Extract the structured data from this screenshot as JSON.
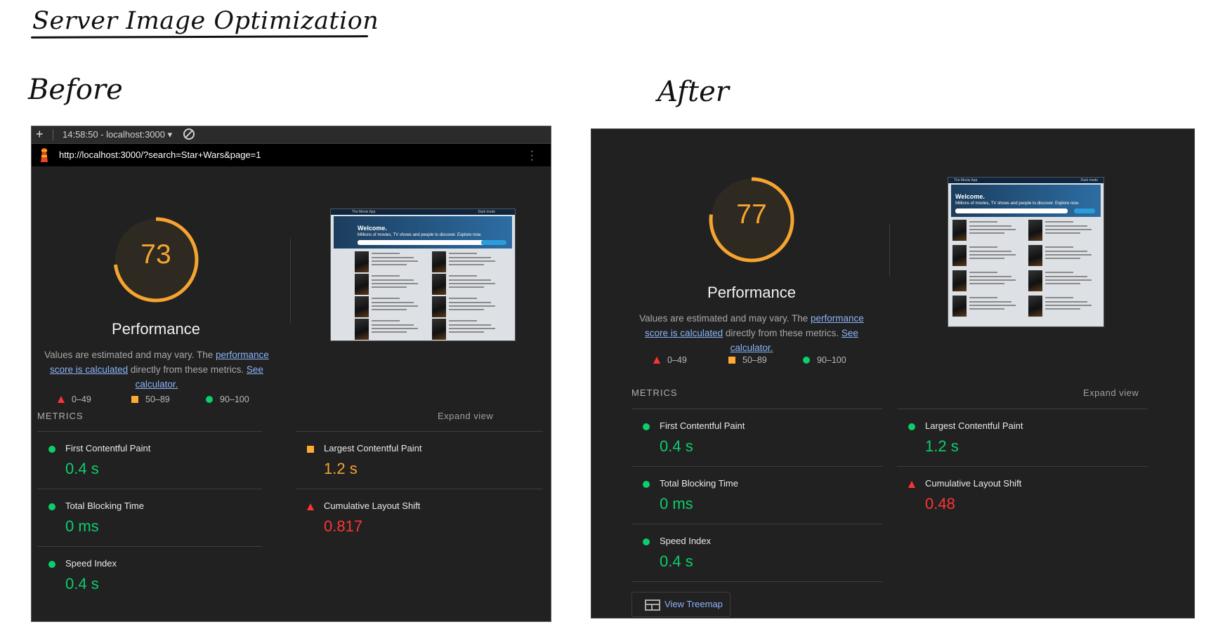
{
  "page": {
    "title": "Server Image Optimization",
    "before_label": "Before",
    "after_label": "After"
  },
  "before": {
    "devtools": {
      "session": "14:58:50 - localhost:3000 ▾",
      "url": "http://localhost:3000/?search=Star+Wars&page=1"
    },
    "score": "73",
    "score_fraction": 0.73,
    "category": "Performance",
    "desc_prefix": "Values are estimated and may vary. The ",
    "desc_link1": "performance score is calculated",
    "desc_middle": " directly from these metrics. ",
    "desc_link2": "See calculator.",
    "legend": [
      "0–49",
      "50–89",
      "90–100"
    ],
    "metrics_heading": "METRICS",
    "expand_label": "Expand view",
    "metrics": [
      {
        "label": "First Contentful Paint",
        "value": "0.4 s",
        "rating": "good"
      },
      {
        "label": "Largest Contentful Paint",
        "value": "1.2 s",
        "rating": "average"
      },
      {
        "label": "Total Blocking Time",
        "value": "0 ms",
        "rating": "good"
      },
      {
        "label": "Cumulative Layout Shift",
        "value": "0.817",
        "rating": "poor"
      },
      {
        "label": "Speed Index",
        "value": "0.4 s",
        "rating": "good"
      }
    ],
    "thumbnail": {
      "app_name": "The Movie App",
      "mode": "Dark mode",
      "welcome": "Welcome.",
      "subtitle": "Millions of movies, TV shows and people to discover. Explore now."
    }
  },
  "after": {
    "score": "77",
    "score_fraction": 0.77,
    "category": "Performance",
    "desc_prefix": "Values are estimated and may vary. The ",
    "desc_link1": "performance score is calculated",
    "desc_middle": " directly from these metrics. ",
    "desc_link2": "See calculator.",
    "legend": [
      "0–49",
      "50–89",
      "90–100"
    ],
    "metrics_heading": "METRICS",
    "expand_label": "Expand view",
    "metrics": [
      {
        "label": "First Contentful Paint",
        "value": "0.4 s",
        "rating": "good"
      },
      {
        "label": "Largest Contentful Paint",
        "value": "1.2 s",
        "rating": "good"
      },
      {
        "label": "Total Blocking Time",
        "value": "0 ms",
        "rating": "good"
      },
      {
        "label": "Cumulative Layout Shift",
        "value": "0.48",
        "rating": "poor"
      },
      {
        "label": "Speed Index",
        "value": "0.4 s",
        "rating": "good"
      }
    ],
    "treemap_label": "View Treemap",
    "thumbnail": {
      "app_name": "The Movie App",
      "mode": "Dark mode",
      "welcome": "Welcome.",
      "subtitle": "Millions of movies, TV shows and people to discover. Explore now."
    }
  },
  "colors": {
    "good": "#0cce6b",
    "average": "#f5a430",
    "poor": "#ff3333",
    "panel_bg": "#212121",
    "link": "#8ab4f8"
  },
  "icons": {
    "good": "green-circle-icon",
    "average": "orange-square-icon",
    "poor": "red-triangle-icon"
  }
}
